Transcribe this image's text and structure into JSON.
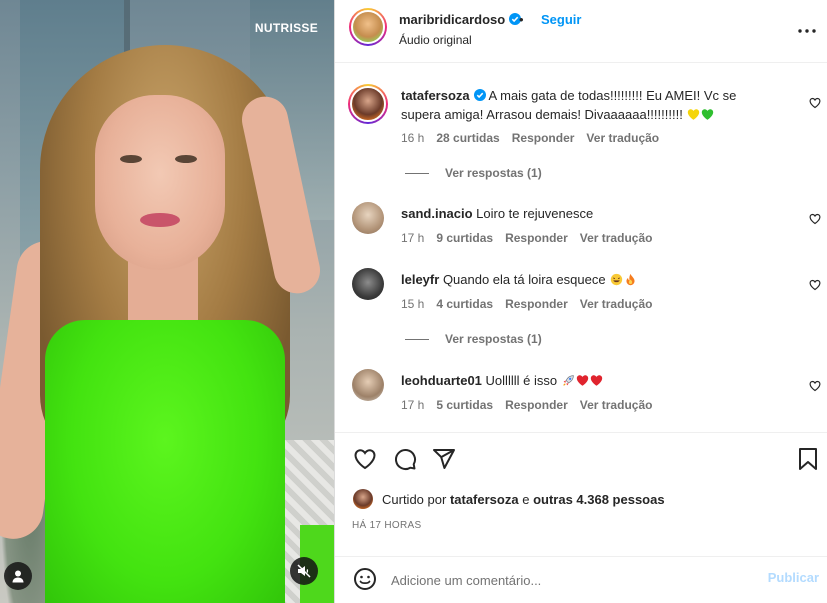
{
  "media": {
    "brand_text": "NUTRISSE",
    "user_tag_icon": "user-tag-icon",
    "mute_icon": "speaker-muted-icon"
  },
  "header": {
    "username": "maribridicardoso",
    "verified": true,
    "separator": "•",
    "follow_label": "Seguir",
    "subtitle": "Áudio original",
    "more_icon": "more-options-icon"
  },
  "comments": [
    {
      "username": "tatafersoza",
      "verified": true,
      "text": "A mais gata de todas!!!!!!!!! Eu AMEI! Vc se supera amiga! Arrasou demais! Divaaaaaa!!!!!!!!!!",
      "emojis": [
        "yellow-heart",
        "green-heart"
      ],
      "time": "16 h",
      "likes": "28 curtidas",
      "reply_label": "Responder",
      "translate_label": "Ver tradução",
      "view_replies": "Ver respostas (1)"
    },
    {
      "username": "sand.inacio",
      "verified": false,
      "text": "Loiro te rejuvenesce",
      "emojis": [],
      "time": "17 h",
      "likes": "9 curtidas",
      "reply_label": "Responder",
      "translate_label": "Ver tradução"
    },
    {
      "username": "leleyfr",
      "verified": false,
      "text": "Quando ela tá loira esquece",
      "emojis": [
        "laughing-face",
        "fire"
      ],
      "time": "15 h",
      "likes": "4 curtidas",
      "reply_label": "Responder",
      "translate_label": "Ver tradução",
      "view_replies": "Ver respostas (1)"
    },
    {
      "username": "leohduarte01",
      "verified": false,
      "text": "Uollllll é isso",
      "emojis": [
        "rocket",
        "red-heart",
        "red-heart"
      ],
      "time": "17 h",
      "likes": "5 curtidas",
      "reply_label": "Responder",
      "translate_label": "Ver tradução"
    }
  ],
  "actions": {
    "like_icon": "heart-icon",
    "comment_icon": "comment-bubble-icon",
    "share_icon": "paper-plane-icon",
    "save_icon": "bookmark-icon"
  },
  "likes_summary": {
    "prefix": "Curtido por",
    "user": "tatafersoza",
    "connector": "e",
    "others": "outras 4.368 pessoas"
  },
  "timestamp": "HÁ 17 HORAS",
  "add_comment": {
    "placeholder": "Adicione um comentário...",
    "publish_label": "Publicar",
    "emoji_icon": "smiley-icon"
  },
  "colors": {
    "link_blue": "#0095f6",
    "publish_disabled": "#b3dbff",
    "muted_text": "#737373",
    "dress_green": "#43e310"
  }
}
